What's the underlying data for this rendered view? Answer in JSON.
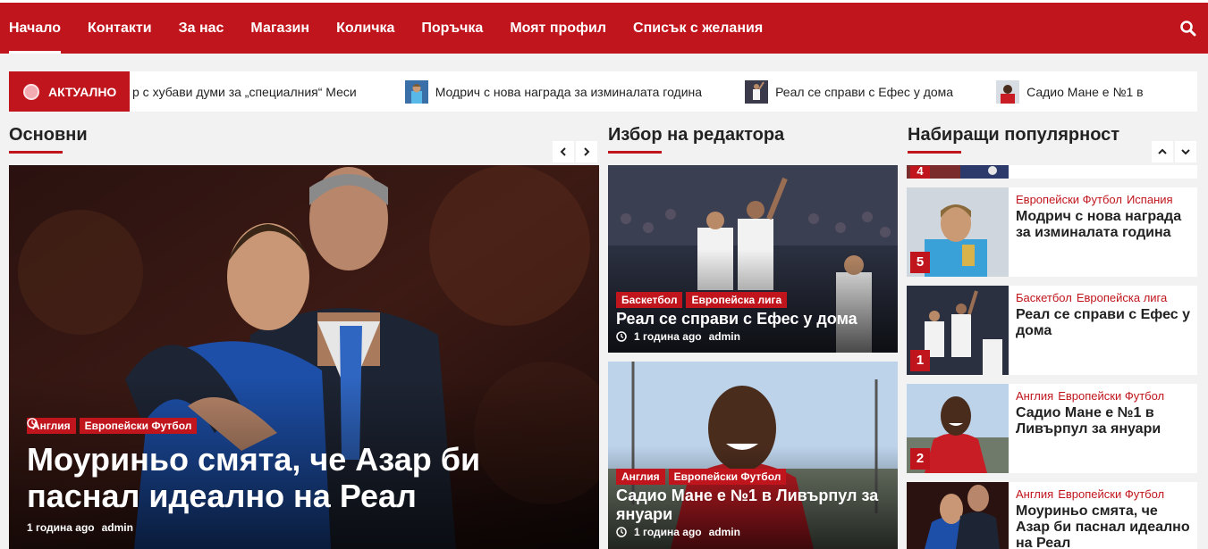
{
  "nav": {
    "items": [
      "Начало",
      "Контакти",
      "За нас",
      "Магазин",
      "Количка",
      "Поръчка",
      "Моят профил",
      "Списък с желания"
    ],
    "search_icon": "search-icon"
  },
  "ticker": {
    "label": "АКТУАЛНО",
    "items": [
      "р с хубави думи за „специалния“ Меси",
      "Модрич с нова награда за изминалата година",
      "Реал се справи с Ефес у дома",
      "Садио Мане е №1 в"
    ]
  },
  "sections": {
    "main": "Основни",
    "editor": "Избор на редактора",
    "trending": "Набиращи популярност"
  },
  "main_story": {
    "categories": [
      "Англия",
      "Европейски Футбол"
    ],
    "title": "Моуриньо смята, че Азар би паснал идеално на Реал",
    "time": "1 година ago",
    "author": "admin"
  },
  "editor_picks": [
    {
      "categories": [
        "Баскетбол",
        "Европейска лига"
      ],
      "title": "Реал се справи с Ефес у дома",
      "time": "1 година ago",
      "author": "admin"
    },
    {
      "categories": [
        "Англия",
        "Европейски Футбол"
      ],
      "title": "Садио Мане е №1 в Ливърпул за януари",
      "time": "1 година ago",
      "author": "admin"
    }
  ],
  "trending": [
    {
      "num": "4",
      "categories": [],
      "title": ""
    },
    {
      "num": "5",
      "categories": [
        "Европейски Футбол",
        "Испания"
      ],
      "title": "Модрич с нова награда за изминалата година"
    },
    {
      "num": "1",
      "categories": [
        "Баскетбол",
        "Европейска лига"
      ],
      "title": "Реал се справи с Ефес у дома"
    },
    {
      "num": "2",
      "categories": [
        "Англия",
        "Европейски Футбол"
      ],
      "title": "Садио Мане е №1 в Ливърпул за януари"
    },
    {
      "num": "",
      "categories": [
        "Англия",
        "Европейски Футбол"
      ],
      "title": "Моуриньо смята, че Азар би паснал идеално на Реал"
    }
  ],
  "colors": {
    "brand": "#c0151c"
  }
}
